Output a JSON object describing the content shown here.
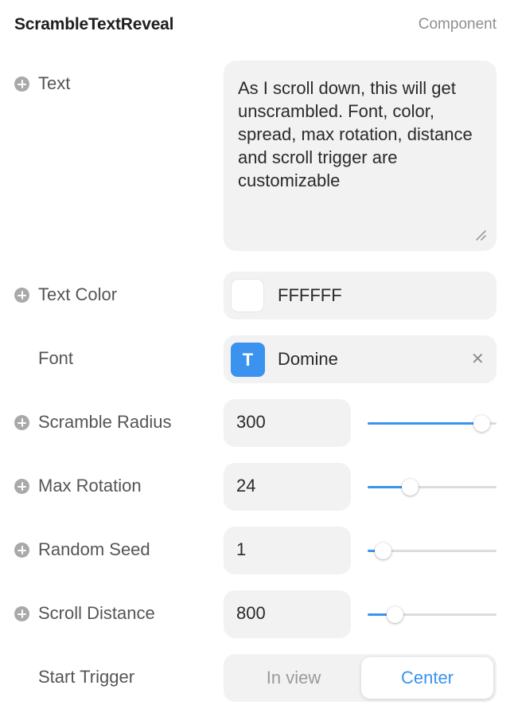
{
  "panel": {
    "title": "ScrambleTextReveal",
    "subtitle": "Component"
  },
  "props": {
    "text": {
      "label": "Text",
      "value": "As I scroll down, this will get unscrambled. Font, color, spread, max rotation, distance and scroll trigger are customizable"
    },
    "text_color": {
      "label": "Text Color",
      "value": "FFFFFF",
      "swatch": "#FFFFFF"
    },
    "font": {
      "label": "Font",
      "value": "Domine",
      "icon_glyph": "T",
      "icon_color": "#3b93ef"
    },
    "scramble_radius": {
      "label": "Scramble Radius",
      "value": "300",
      "slider_fraction": 0.94
    },
    "max_rotation": {
      "label": "Max Rotation",
      "value": "24",
      "slider_fraction": 0.3
    },
    "random_seed": {
      "label": "Random Seed",
      "value": "1",
      "slider_fraction": 0.06
    },
    "scroll_distance": {
      "label": "Scroll Distance",
      "value": "800",
      "slider_fraction": 0.17
    },
    "start_trigger": {
      "label": "Start Trigger",
      "options": [
        "In view",
        "Center"
      ],
      "selected": "Center"
    }
  },
  "icons": {
    "add": "plus-circle-icon",
    "clear": "close-icon",
    "resize": "resize-handle-icon"
  },
  "colors": {
    "accent": "#3b93ef",
    "field_bg": "#f2f2f2"
  }
}
